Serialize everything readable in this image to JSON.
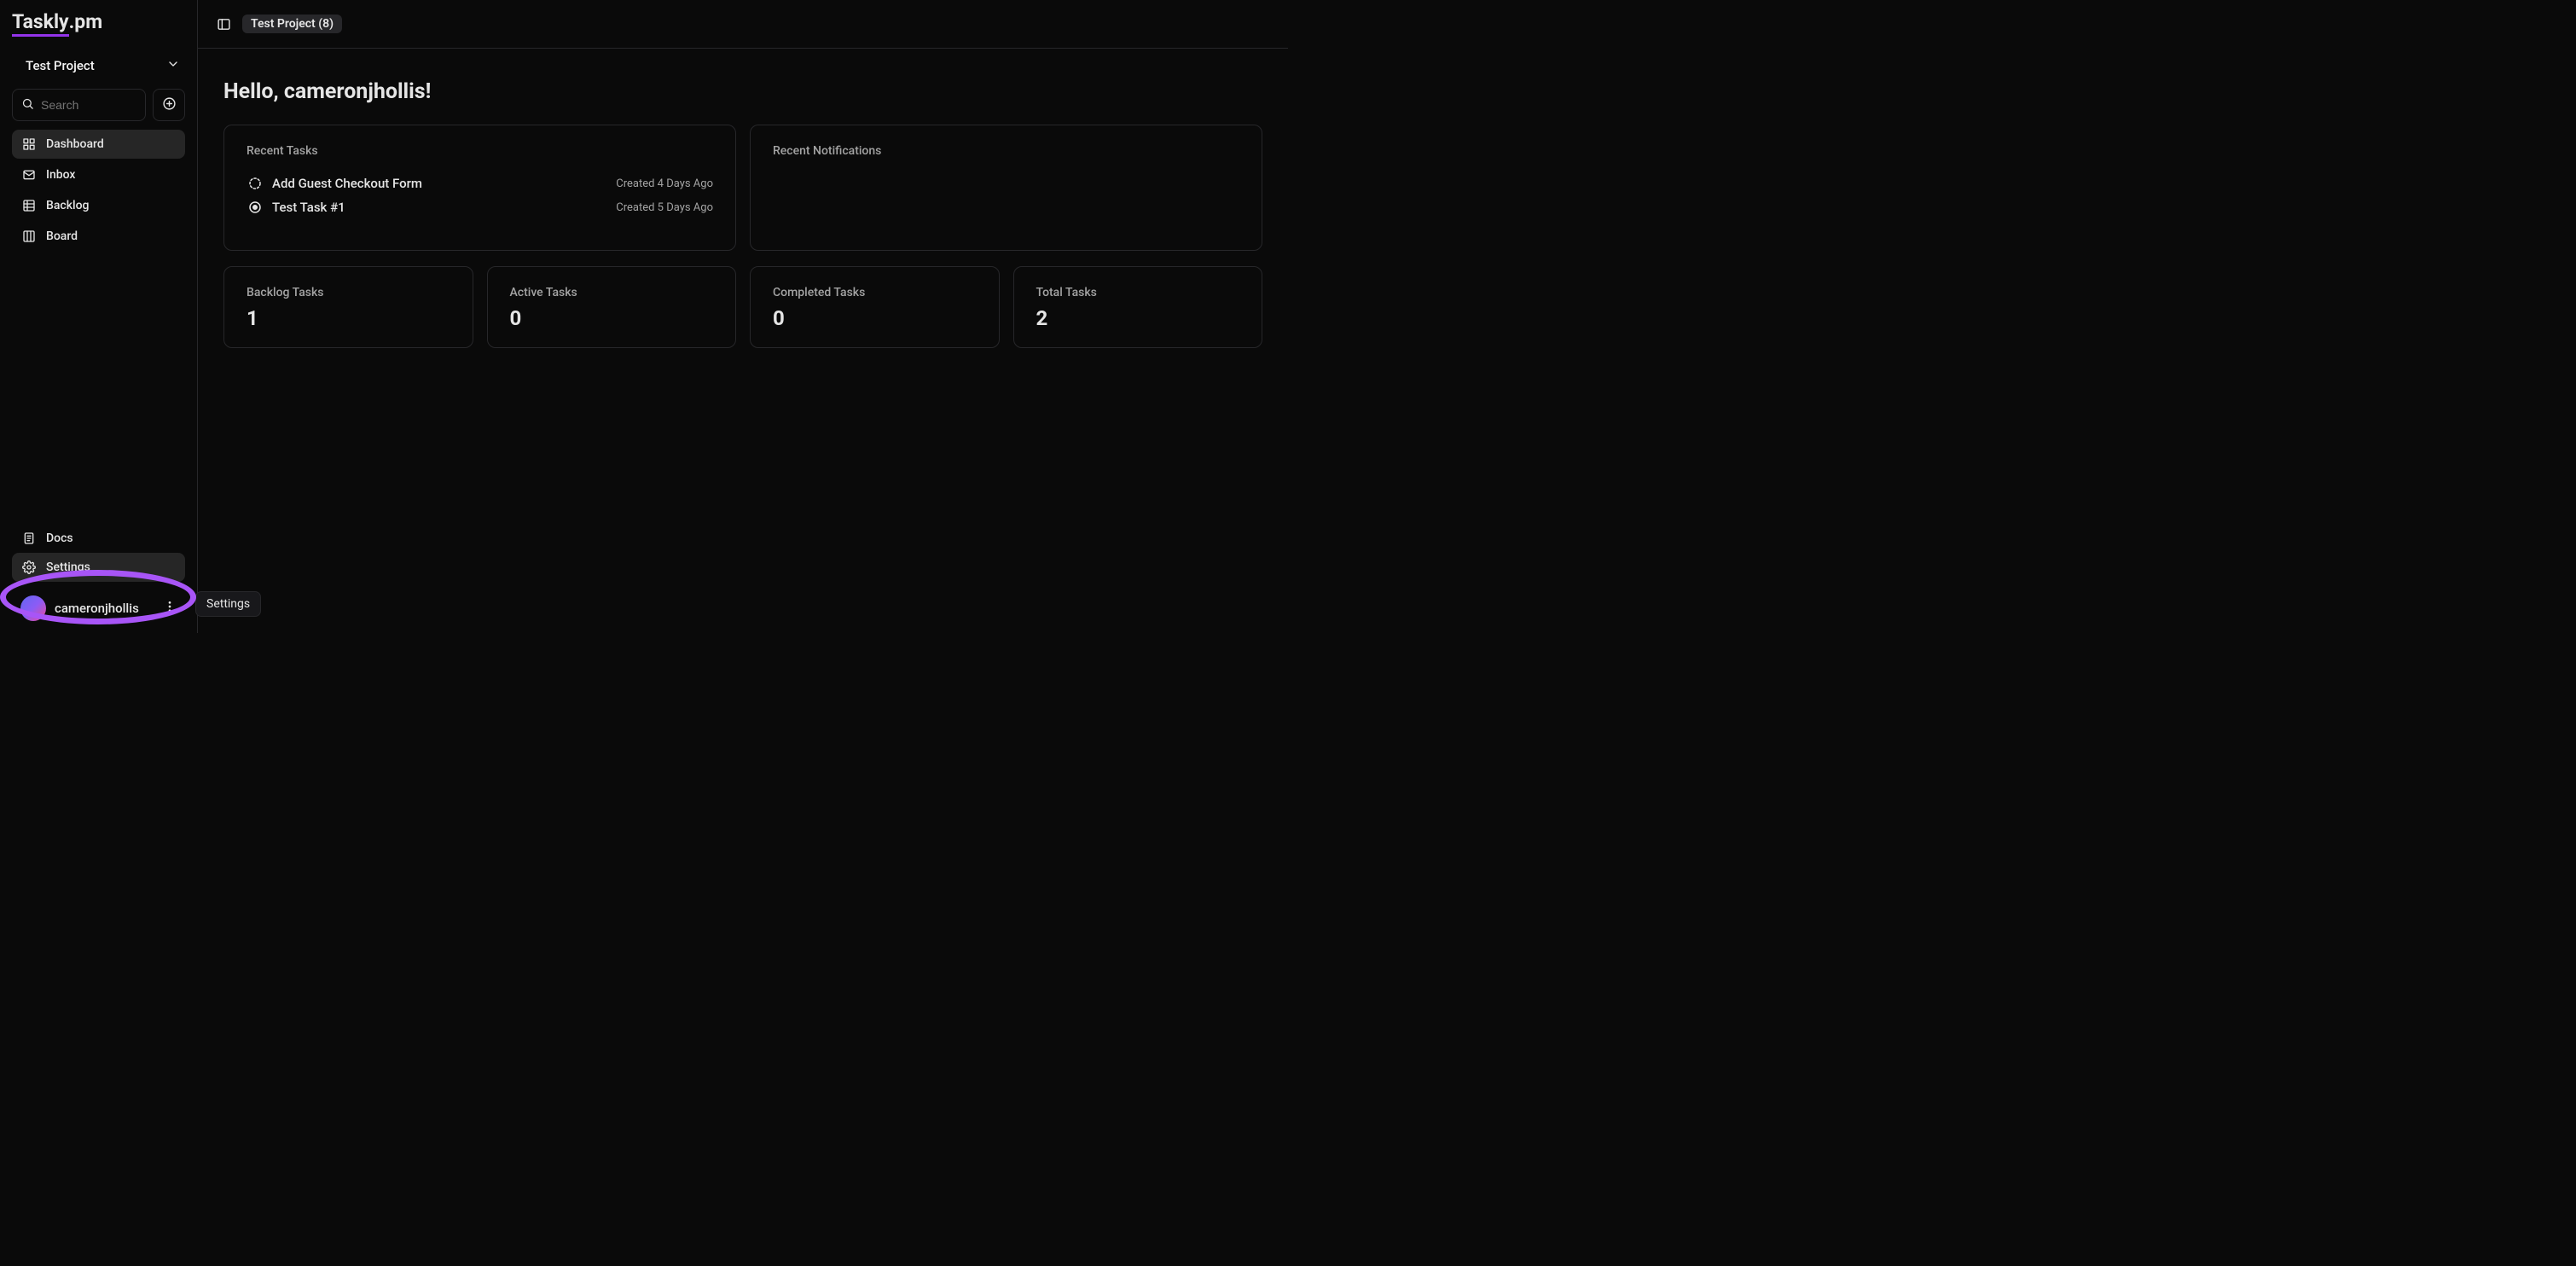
{
  "app": {
    "logo_left": "Taskly",
    "logo_right": ".pm"
  },
  "sidebar": {
    "project": "Test Project",
    "search_placeholder": "Search",
    "nav": [
      {
        "label": "Dashboard",
        "icon": "dashboard-icon",
        "active": true
      },
      {
        "label": "Inbox",
        "icon": "inbox-icon"
      },
      {
        "label": "Backlog",
        "icon": "backlog-icon"
      },
      {
        "label": "Board",
        "icon": "board-icon"
      }
    ],
    "bottom_nav": [
      {
        "label": "Docs",
        "icon": "docs-icon"
      },
      {
        "label": "Settings",
        "icon": "settings-icon",
        "hovered": true
      }
    ],
    "user": "cameronjhollis"
  },
  "topbar": {
    "breadcrumb": "Test Project (8)"
  },
  "main": {
    "greeting": "Hello, cameronjhollis!",
    "recent_tasks_title": "Recent Tasks",
    "recent_tasks": [
      {
        "title": "Add Guest Checkout Form",
        "meta": "Created 4 Days Ago",
        "status": "dashed"
      },
      {
        "title": "Test Task #1",
        "meta": "Created 5 Days Ago",
        "status": "active"
      }
    ],
    "recent_notifications_title": "Recent Notifications",
    "stats": [
      {
        "label": "Backlog Tasks",
        "value": "1"
      },
      {
        "label": "Active Tasks",
        "value": "0"
      },
      {
        "label": "Completed Tasks",
        "value": "0"
      },
      {
        "label": "Total Tasks",
        "value": "2"
      }
    ]
  },
  "tooltip": "Settings"
}
